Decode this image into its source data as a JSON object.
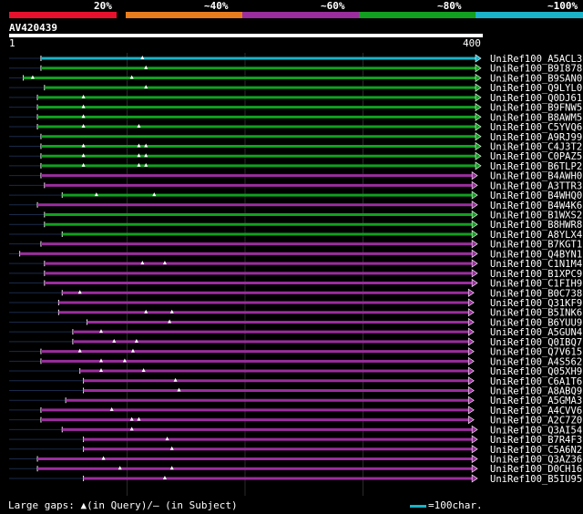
{
  "query_id": "AV420439",
  "legend": [
    {
      "label": "20%",
      "color": "#e8112d"
    },
    {
      "label": "~40%",
      "color": "#e87d1e"
    },
    {
      "label": "~60%",
      "color": "#9b2d9e"
    },
    {
      "label": "~80%",
      "color": "#11a01f"
    },
    {
      "label": "~100%",
      "color": "#1ab3c8"
    }
  ],
  "scale": {
    "start_label": "1",
    "end_label": "400"
  },
  "footer": {
    "gaps_text": "Large gaps: ▲(in Query)/– (in Subject)",
    "key_text": "=100char."
  },
  "chart_data": {
    "type": "alignment",
    "query_length": 400,
    "hits": [
      {
        "name": "UniRef100_A5ACL3",
        "color": "#1ab3c8",
        "start": 27,
        "end": 400,
        "gaps": [
          113
        ]
      },
      {
        "name": "UniRef100_B9I878",
        "color": "#11a01f",
        "start": 27,
        "end": 400,
        "gaps": [
          116
        ]
      },
      {
        "name": "UniRef100_B9SAN0",
        "color": "#11a01f",
        "start": 12,
        "end": 400,
        "gaps": [
          20,
          104
        ]
      },
      {
        "name": "UniRef100_Q9LYL0",
        "color": "#11a01f",
        "start": 30,
        "end": 400,
        "gaps": [
          116
        ]
      },
      {
        "name": "UniRef100_Q0DJ61",
        "color": "#11a01f",
        "start": 24,
        "end": 400,
        "gaps": [
          63
        ]
      },
      {
        "name": "UniRef100_B9FNW5",
        "color": "#11a01f",
        "start": 24,
        "end": 400,
        "gaps": [
          63
        ]
      },
      {
        "name": "UniRef100_B8AWM5",
        "color": "#11a01f",
        "start": 24,
        "end": 400,
        "gaps": [
          63
        ]
      },
      {
        "name": "UniRef100_C5YVQ6",
        "color": "#11a01f",
        "start": 24,
        "end": 400,
        "gaps": [
          63,
          110
        ]
      },
      {
        "name": "UniRef100_A9RJ99",
        "color": "#11a01f",
        "start": 27,
        "end": 400,
        "gaps": []
      },
      {
        "name": "UniRef100_C4J3T2",
        "color": "#11a01f",
        "start": 27,
        "end": 400,
        "gaps": [
          63,
          110,
          116
        ]
      },
      {
        "name": "UniRef100_C0PAZ5",
        "color": "#11a01f",
        "start": 27,
        "end": 400,
        "gaps": [
          63,
          110,
          116
        ]
      },
      {
        "name": "UniRef100_B6TLP2",
        "color": "#11a01f",
        "start": 27,
        "end": 400,
        "gaps": [
          63,
          110,
          116
        ]
      },
      {
        "name": "UniRef100_B4AWH0",
        "color": "#9b2d9e",
        "start": 27,
        "end": 397,
        "gaps": []
      },
      {
        "name": "UniRef100_A3TTR3",
        "color": "#9b2d9e",
        "start": 30,
        "end": 397,
        "gaps": []
      },
      {
        "name": "UniRef100_B4WHQ0",
        "color": "#11a01f",
        "start": 45,
        "end": 397,
        "gaps": [
          74,
          123
        ]
      },
      {
        "name": "UniRef100_B4W4K6",
        "color": "#9b2d9e",
        "start": 24,
        "end": 397,
        "gaps": []
      },
      {
        "name": "UniRef100_B1WXS2",
        "color": "#11a01f",
        "start": 30,
        "end": 397,
        "gaps": []
      },
      {
        "name": "UniRef100_B8HWR8",
        "color": "#11a01f",
        "start": 30,
        "end": 397,
        "gaps": []
      },
      {
        "name": "UniRef100_A8YLX4",
        "color": "#11a01f",
        "start": 45,
        "end": 397,
        "gaps": []
      },
      {
        "name": "UniRef100_B7KGT1",
        "color": "#9b2d9e",
        "start": 27,
        "end": 397,
        "gaps": []
      },
      {
        "name": "UniRef100_Q4BYN1",
        "color": "#9b2d9e",
        "start": 9,
        "end": 397,
        "gaps": []
      },
      {
        "name": "UniRef100_C1N1M4",
        "color": "#9b2d9e",
        "start": 30,
        "end": 397,
        "gaps": [
          113,
          132
        ]
      },
      {
        "name": "UniRef100_B1XPC9",
        "color": "#9b2d9e",
        "start": 30,
        "end": 397,
        "gaps": []
      },
      {
        "name": "UniRef100_C1FIH9",
        "color": "#9b2d9e",
        "start": 30,
        "end": 397,
        "gaps": []
      },
      {
        "name": "UniRef100_B0C738",
        "color": "#9b2d9e",
        "start": 45,
        "end": 394,
        "gaps": [
          60
        ]
      },
      {
        "name": "UniRef100_Q31KF9",
        "color": "#9b2d9e",
        "start": 42,
        "end": 394,
        "gaps": []
      },
      {
        "name": "UniRef100_B5INK6",
        "color": "#9b2d9e",
        "start": 42,
        "end": 394,
        "gaps": [
          116,
          138
        ]
      },
      {
        "name": "UniRef100_B6YUU9",
        "color": "#9b2d9e",
        "start": 66,
        "end": 394,
        "gaps": [
          136
        ]
      },
      {
        "name": "UniRef100_A5GUN4",
        "color": "#9b2d9e",
        "start": 54,
        "end": 394,
        "gaps": [
          78
        ]
      },
      {
        "name": "UniRef100_Q0IBQ7",
        "color": "#9b2d9e",
        "start": 54,
        "end": 394,
        "gaps": [
          89,
          108
        ]
      },
      {
        "name": "UniRef100_Q7V615",
        "color": "#9b2d9e",
        "start": 27,
        "end": 394,
        "gaps": [
          60,
          105
        ]
      },
      {
        "name": "UniRef100_A4S562",
        "color": "#9b2d9e",
        "start": 27,
        "end": 394,
        "gaps": [
          78,
          98
        ]
      },
      {
        "name": "UniRef100_Q05XH9",
        "color": "#9b2d9e",
        "start": 60,
        "end": 394,
        "gaps": [
          78,
          114
        ]
      },
      {
        "name": "UniRef100_C6A1T6",
        "color": "#9b2d9e",
        "start": 63,
        "end": 394,
        "gaps": [
          141
        ]
      },
      {
        "name": "UniRef100_A8ABQ9",
        "color": "#9b2d9e",
        "start": 63,
        "end": 394,
        "gaps": [
          144
        ]
      },
      {
        "name": "UniRef100_A5GMA3",
        "color": "#9b2d9e",
        "start": 48,
        "end": 394,
        "gaps": []
      },
      {
        "name": "UniRef100_A4CVV6",
        "color": "#9b2d9e",
        "start": 27,
        "end": 394,
        "gaps": [
          87
        ]
      },
      {
        "name": "UniRef100_A2C7Z0",
        "color": "#9b2d9e",
        "start": 27,
        "end": 394,
        "gaps": [
          104,
          110
        ]
      },
      {
        "name": "UniRef100_Q3AI54",
        "color": "#9b2d9e",
        "start": 45,
        "end": 397,
        "gaps": [
          104
        ]
      },
      {
        "name": "UniRef100_B7R4F3",
        "color": "#9b2d9e",
        "start": 63,
        "end": 397,
        "gaps": [
          134
        ]
      },
      {
        "name": "UniRef100_C5A6N2",
        "color": "#9b2d9e",
        "start": 63,
        "end": 397,
        "gaps": [
          138
        ]
      },
      {
        "name": "UniRef100_Q3AZ36",
        "color": "#9b2d9e",
        "start": 24,
        "end": 397,
        "gaps": [
          80
        ]
      },
      {
        "name": "UniRef100_D0CH16",
        "color": "#9b2d9e",
        "start": 24,
        "end": 397,
        "gaps": [
          94,
          138
        ]
      },
      {
        "name": "UniRef100_B5IU95",
        "color": "#9b2d9e",
        "start": 63,
        "end": 397,
        "gaps": [
          132
        ]
      }
    ]
  }
}
